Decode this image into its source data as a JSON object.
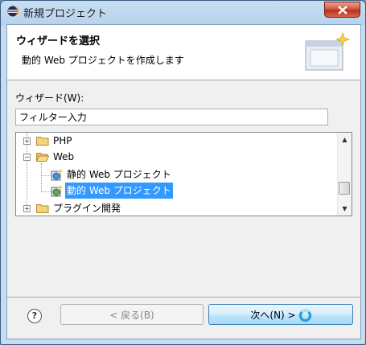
{
  "window": {
    "title": "新規プロジェクト"
  },
  "banner": {
    "title": "ウィザードを選択",
    "description": "動的 Web プロジェクトを作成します"
  },
  "wizards": {
    "label": "ウィザード(W):",
    "filter_value": "フィルター入力"
  },
  "tree": {
    "items": [
      {
        "label": "PHP",
        "expanded": false
      },
      {
        "label": "Web",
        "expanded": true
      },
      {
        "label": "静的 Web プロジェクト"
      },
      {
        "label": "動的 Web プロジェクト",
        "selected": true
      },
      {
        "label": "プラグイン開発",
        "expanded": false
      }
    ]
  },
  "buttons": {
    "help": "?",
    "back": "< 戻る(B)",
    "next": "次へ(N) >"
  },
  "colors": {
    "selection": "#3399ff",
    "next_button": "#bee6fd",
    "close_button": "#c94a31"
  }
}
